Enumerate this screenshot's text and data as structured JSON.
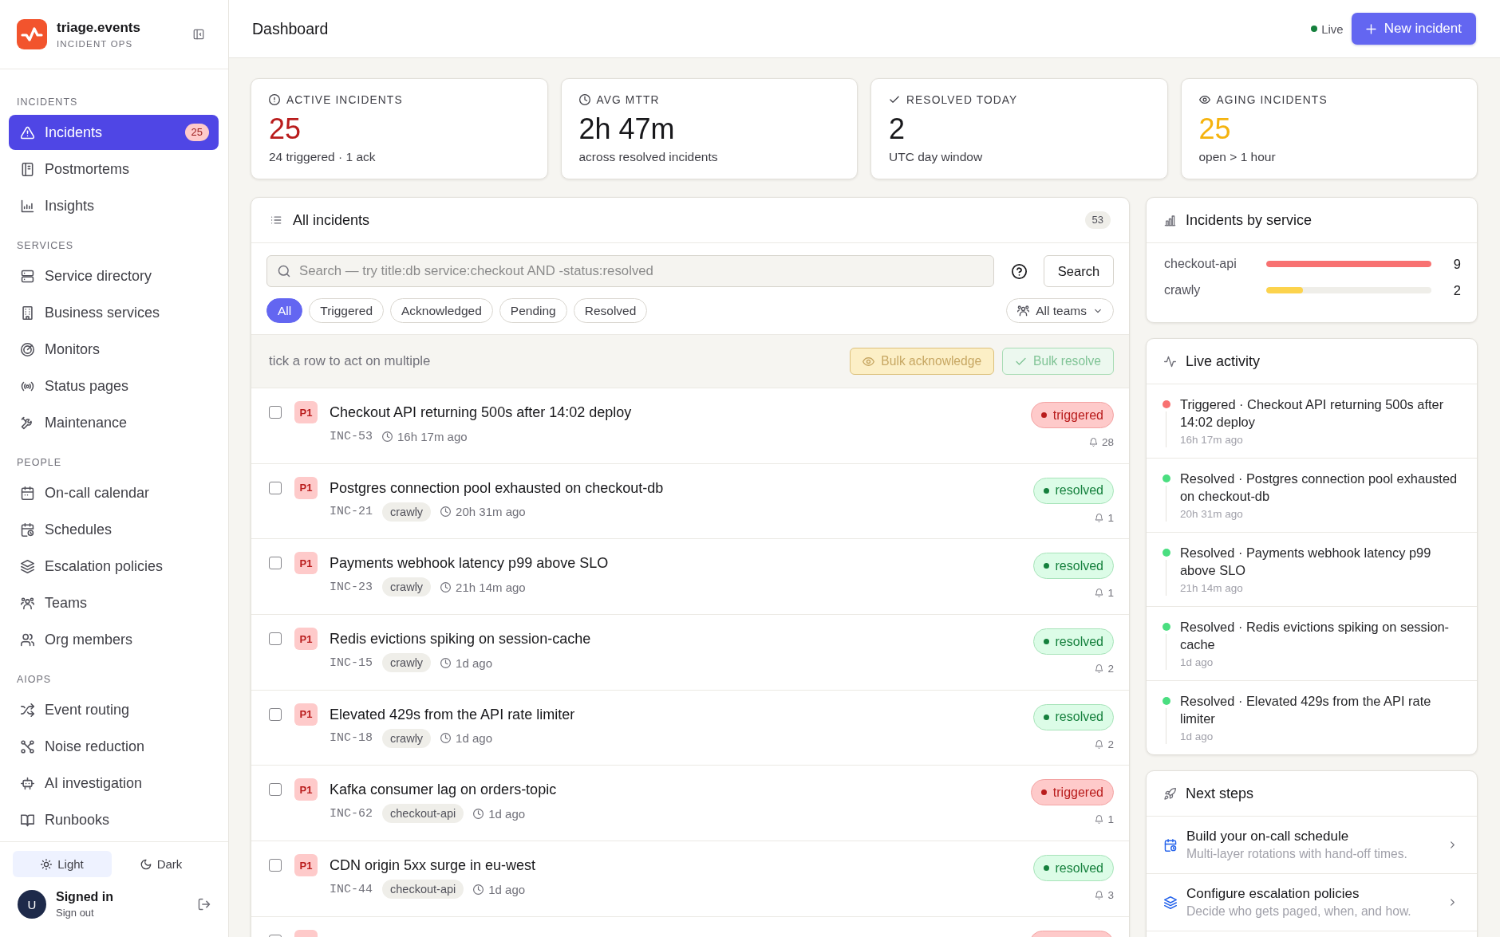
{
  "sidebar": {
    "brand": {
      "name": "triage.events",
      "tagline": "INCIDENT OPS"
    },
    "sections": [
      {
        "label": "INCIDENTS",
        "items": [
          {
            "label": "Incidents",
            "selected": true,
            "badge": "25"
          },
          {
            "label": "Postmortems",
            "selected": false
          },
          {
            "label": "Insights",
            "selected": false
          }
        ]
      },
      {
        "label": "SERVICES",
        "items": [
          {
            "label": "Service directory",
            "selected": false
          },
          {
            "label": "Business services",
            "selected": false
          },
          {
            "label": "Monitors",
            "selected": false
          },
          {
            "label": "Status pages",
            "selected": false
          },
          {
            "label": "Maintenance",
            "selected": false
          }
        ]
      },
      {
        "label": "PEOPLE",
        "items": [
          {
            "label": "On-call calendar",
            "selected": false
          },
          {
            "label": "Schedules",
            "selected": false
          },
          {
            "label": "Escalation policies",
            "selected": false
          },
          {
            "label": "Teams",
            "selected": false
          },
          {
            "label": "Org members",
            "selected": false
          }
        ]
      },
      {
        "label": "AIOPS",
        "items": [
          {
            "label": "Event routing",
            "selected": false
          },
          {
            "label": "Noise reduction",
            "selected": false
          },
          {
            "label": "AI investigation",
            "selected": false
          },
          {
            "label": "Runbooks",
            "selected": false
          }
        ]
      }
    ],
    "theme": [
      {
        "label": "Light",
        "selected": true
      },
      {
        "label": "Dark",
        "selected": false
      }
    ],
    "user": {
      "avatar": "U",
      "status": "Signed in",
      "action": "Sign out"
    }
  },
  "header": {
    "title": "Dashboard",
    "live_label": "Live",
    "primary_button": "New incident"
  },
  "stats": [
    {
      "label": "ACTIVE INCIDENTS",
      "value": "25",
      "color": "#b91c1c",
      "detail": "24 triggered · 1 ack"
    },
    {
      "label": "AVG MTTR",
      "value": "2h 47m",
      "color": "#18181b",
      "detail": "across resolved incidents"
    },
    {
      "label": "RESOLVED TODAY",
      "value": "2",
      "color": "#18181b",
      "detail": "UTC day window"
    },
    {
      "label": "AGING INCIDENTS",
      "value": "25",
      "color": "#f5b30e",
      "detail": "open > 1 hour"
    }
  ],
  "incidents": {
    "title": "All incidents",
    "count": "53",
    "search": {
      "placeholder": "Search — try title:db service:checkout AND -status:resolved"
    },
    "search_button": "Search",
    "filters": [
      {
        "label": "All",
        "selected": true
      },
      {
        "label": "Triggered",
        "selected": false
      },
      {
        "label": "Acknowledged",
        "selected": false
      },
      {
        "label": "Pending",
        "selected": false
      },
      {
        "label": "Resolved",
        "selected": false
      }
    ],
    "team_filter": "All teams",
    "bulk": {
      "hint": "tick a row to act on multiple",
      "buttons": [
        {
          "label": "Bulk acknowledge",
          "kind": "acknowledge",
          "disabled": true
        },
        {
          "label": "Bulk resolve",
          "kind": "resolve",
          "disabled": true
        }
      ]
    },
    "rows": [
      {
        "checked": false,
        "priority": "P1",
        "title": "Checkout API returning 500s after 14:02 deploy",
        "id": "INC-53",
        "time": "16h 17m ago",
        "status": {
          "kind": "triggered",
          "label": "triggered"
        },
        "alerts": "28"
      },
      {
        "checked": false,
        "priority": "P1",
        "title": "Postgres connection pool exhausted on checkout-db",
        "id": "INC-21",
        "service": "crawly",
        "time": "20h 31m ago",
        "status": {
          "kind": "resolved",
          "label": "resolved"
        },
        "alerts": "1"
      },
      {
        "checked": false,
        "priority": "P1",
        "title": "Payments webhook latency p99 above SLO",
        "id": "INC-23",
        "service": "crawly",
        "time": "21h 14m ago",
        "status": {
          "kind": "resolved",
          "label": "resolved"
        },
        "alerts": "1"
      },
      {
        "checked": false,
        "priority": "P1",
        "title": "Redis evictions spiking on session-cache",
        "id": "INC-15",
        "service": "crawly",
        "time": "1d ago",
        "status": {
          "kind": "resolved",
          "label": "resolved"
        },
        "alerts": "2"
      },
      {
        "checked": false,
        "priority": "P1",
        "title": "Elevated 429s from the API rate limiter",
        "id": "INC-18",
        "service": "crawly",
        "time": "1d ago",
        "status": {
          "kind": "resolved",
          "label": "resolved"
        },
        "alerts": "2"
      },
      {
        "checked": false,
        "priority": "P1",
        "title": "Kafka consumer lag on orders-topic",
        "id": "INC-62",
        "service": "checkout-api",
        "time": "1d ago",
        "status": {
          "kind": "triggered",
          "label": "triggered"
        },
        "alerts": "1"
      },
      {
        "checked": false,
        "priority": "P1",
        "title": "CDN origin 5xx surge in eu-west",
        "id": "INC-44",
        "service": "checkout-api",
        "time": "1d ago",
        "status": {
          "kind": "resolved",
          "label": "resolved"
        },
        "alerts": "3"
      },
      {
        "checked": false,
        "status": {
          "kind": "triggered"
        }
      }
    ]
  },
  "by_service": {
    "title": "Incidents by service",
    "items": [
      {
        "name": "checkout-api",
        "level": 1,
        "color": "#f87171",
        "count": "9"
      },
      {
        "name": "crawly",
        "level": 0.22,
        "color": "#fcd34d",
        "count": "2"
      }
    ]
  },
  "activity": {
    "title": "Live activity",
    "items": [
      {
        "text": "Triggered · Checkout API returning 500s after 14:02 deploy",
        "time": "16h 17m ago",
        "color": "#f87171"
      },
      {
        "text": "Resolved · Postgres connection pool exhausted on checkout-db",
        "time": "20h 31m ago",
        "color": "#4ade80"
      },
      {
        "text": "Resolved · Payments webhook latency p99 above SLO",
        "time": "21h 14m ago",
        "color": "#4ade80"
      },
      {
        "text": "Resolved · Redis evictions spiking on session-cache",
        "time": "1d ago",
        "color": "#4ade80"
      },
      {
        "text": "Resolved · Elevated 429s from the API rate limiter",
        "time": "1d ago",
        "color": "#4ade80"
      }
    ]
  },
  "next_steps": {
    "title": "Next steps",
    "items": [
      {
        "title": "Build your on-call schedule",
        "description": "Multi-layer rotations with hand-off times."
      },
      {
        "title": "Configure escalation policies",
        "description": "Decide who gets paged, when, and how."
      }
    ]
  }
}
